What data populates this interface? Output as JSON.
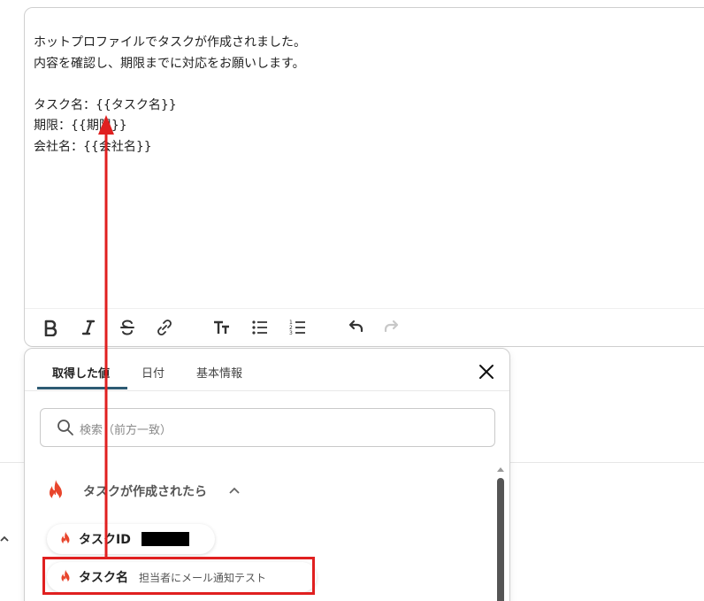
{
  "editor": {
    "lines": [
      "ホットプロファイルでタスクが作成されました。",
      "内容を確認し、期限までに対応をお願いします。",
      "",
      "タスク名：{{タスク名}}",
      "期限：{{期限}}",
      "会社名：{{会社名}}"
    ],
    "toolbar": [
      "bold-icon",
      "italic-icon",
      "strikethrough-icon",
      "link-icon",
      "text-size-icon",
      "bullet-list-icon",
      "numbered-list-icon",
      "undo-icon",
      "redo-icon"
    ]
  },
  "popup": {
    "tabs": [
      {
        "label": "取得した値"
      },
      {
        "label": "日付"
      },
      {
        "label": "基本情報"
      }
    ],
    "search_placeholder": "検索（前方一致）",
    "section": {
      "title": "タスクが作成されたら"
    },
    "items": [
      {
        "name": "タスクID",
        "value": ""
      },
      {
        "name": "タスク名",
        "value": "担当者にメール通知テスト"
      }
    ]
  },
  "colors": {
    "accent": "#2d5b73",
    "flame": "#e8452c",
    "annotation": "#e02020"
  }
}
